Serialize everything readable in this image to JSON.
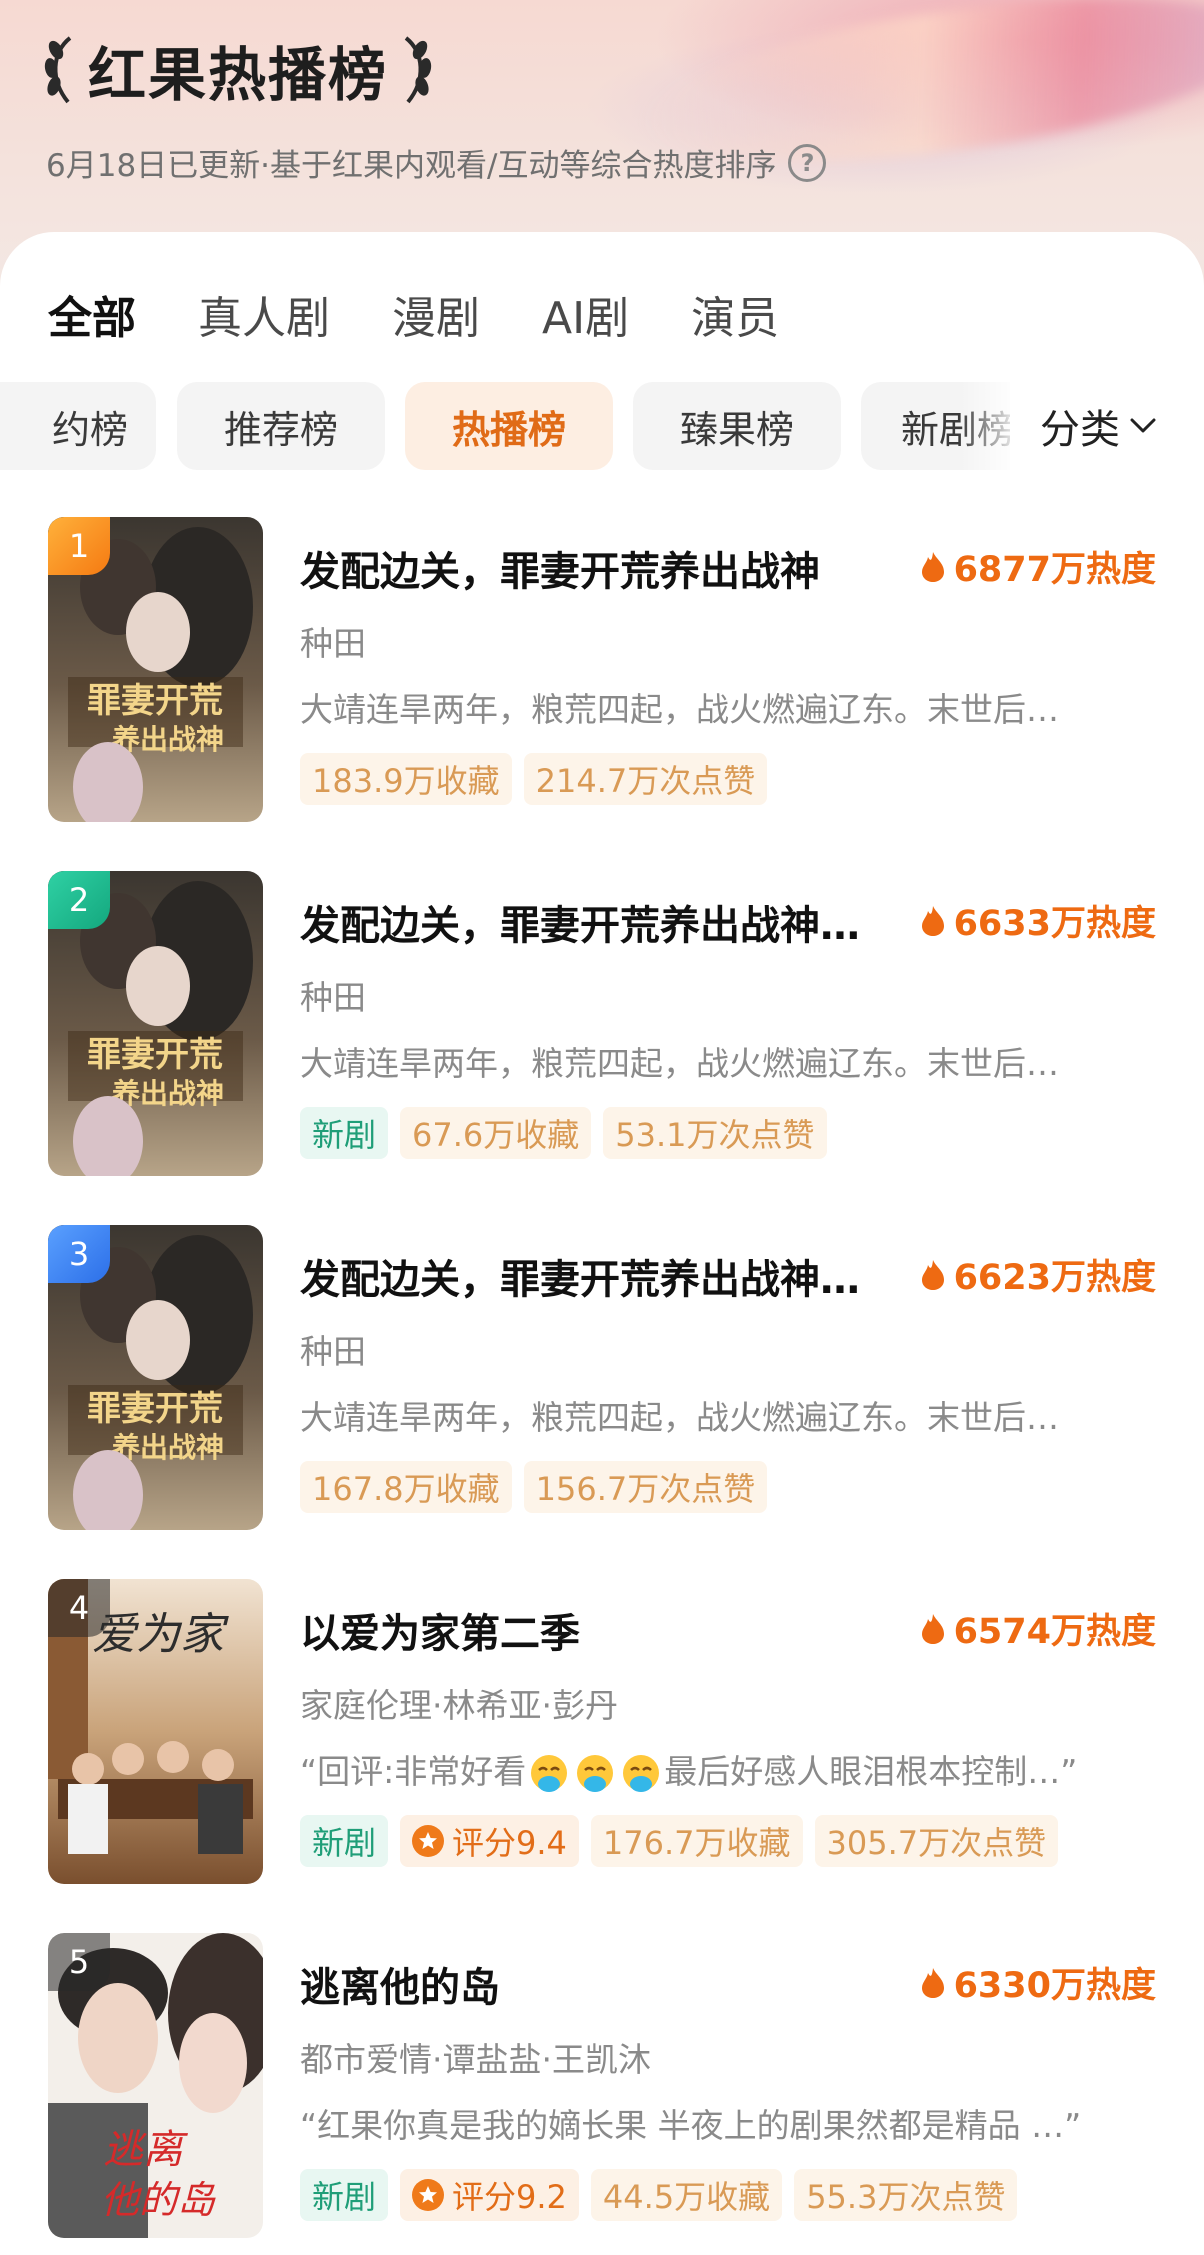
{
  "header": {
    "title": "红果热播榜",
    "subtitle": "6月18日已更新·基于红果内观看/互动等综合热度排序",
    "help_glyph": "?"
  },
  "tabs": [
    {
      "label": "全部",
      "active": true
    },
    {
      "label": "真人剧",
      "active": false
    },
    {
      "label": "漫剧",
      "active": false
    },
    {
      "label": "AI剧",
      "active": false
    },
    {
      "label": "演员",
      "active": false
    }
  ],
  "chips": [
    {
      "label": "约榜",
      "active": false
    },
    {
      "label": "推荐榜",
      "active": false
    },
    {
      "label": "热播榜",
      "active": true
    },
    {
      "label": "臻果榜",
      "active": false
    },
    {
      "label": "新剧榜",
      "active": false
    }
  ],
  "filter": {
    "label": "分类"
  },
  "items": [
    {
      "rank": "1",
      "title": "发配边关，罪妻开荒养出战神",
      "heat": "6877万热度",
      "genre": "种田",
      "desc": "大靖连旱两年，粮荒四起，战火燃遍辽东。末世后…",
      "tags": {
        "new": "",
        "score": "",
        "fav": "183.9万收藏",
        "like": "214.7万次点赞"
      }
    },
    {
      "rank": "2",
      "title": "发配边关，罪妻开荒养出战神…",
      "heat": "6633万热度",
      "genre": "种田",
      "desc": "大靖连旱两年，粮荒四起，战火燃遍辽东。末世后…",
      "tags": {
        "new": "新剧",
        "score": "",
        "fav": "67.6万收藏",
        "like": "53.1万次点赞"
      }
    },
    {
      "rank": "3",
      "title": "发配边关，罪妻开荒养出战神…",
      "heat": "6623万热度",
      "genre": "种田",
      "desc": "大靖连旱两年，粮荒四起，战火燃遍辽东。末世后…",
      "tags": {
        "new": "",
        "score": "",
        "fav": "167.8万收藏",
        "like": "156.7万次点赞"
      }
    },
    {
      "rank": "4",
      "title": "以爱为家第二季",
      "heat": "6574万热度",
      "genre": "家庭伦理·林希亚·彭丹",
      "desc_pre": "“回评:非常好看",
      "desc_post": "最后好感人眼泪根本控制…”",
      "tags": {
        "new": "新剧",
        "score": "评分9.4",
        "fav": "176.7万收藏",
        "like": "305.7万次点赞"
      }
    },
    {
      "rank": "5",
      "title": "逃离他的岛",
      "heat": "6330万热度",
      "genre": "都市爱情·谭盐盐·王凯沐",
      "desc": "“红果你真是我的嫡长果 半夜上的剧果然都是精品 …”",
      "tags": {
        "new": "新剧",
        "score": "评分9.2",
        "fav": "44.5万收藏",
        "like": "55.3万次点赞"
      }
    }
  ],
  "colors": {
    "accent": "#ee6a12",
    "new_tag": "#1f9e78",
    "tag_text": "#d99a55",
    "rank1": "#f57a12",
    "rank2": "#14a77e",
    "rank3": "#2c6fe8"
  },
  "icons": {
    "heat": "flame-icon",
    "score": "star-badge-icon",
    "filter": "chevron-down-icon",
    "laurel": "laurel-icon",
    "emoji": "shuang-emoji-icon"
  }
}
